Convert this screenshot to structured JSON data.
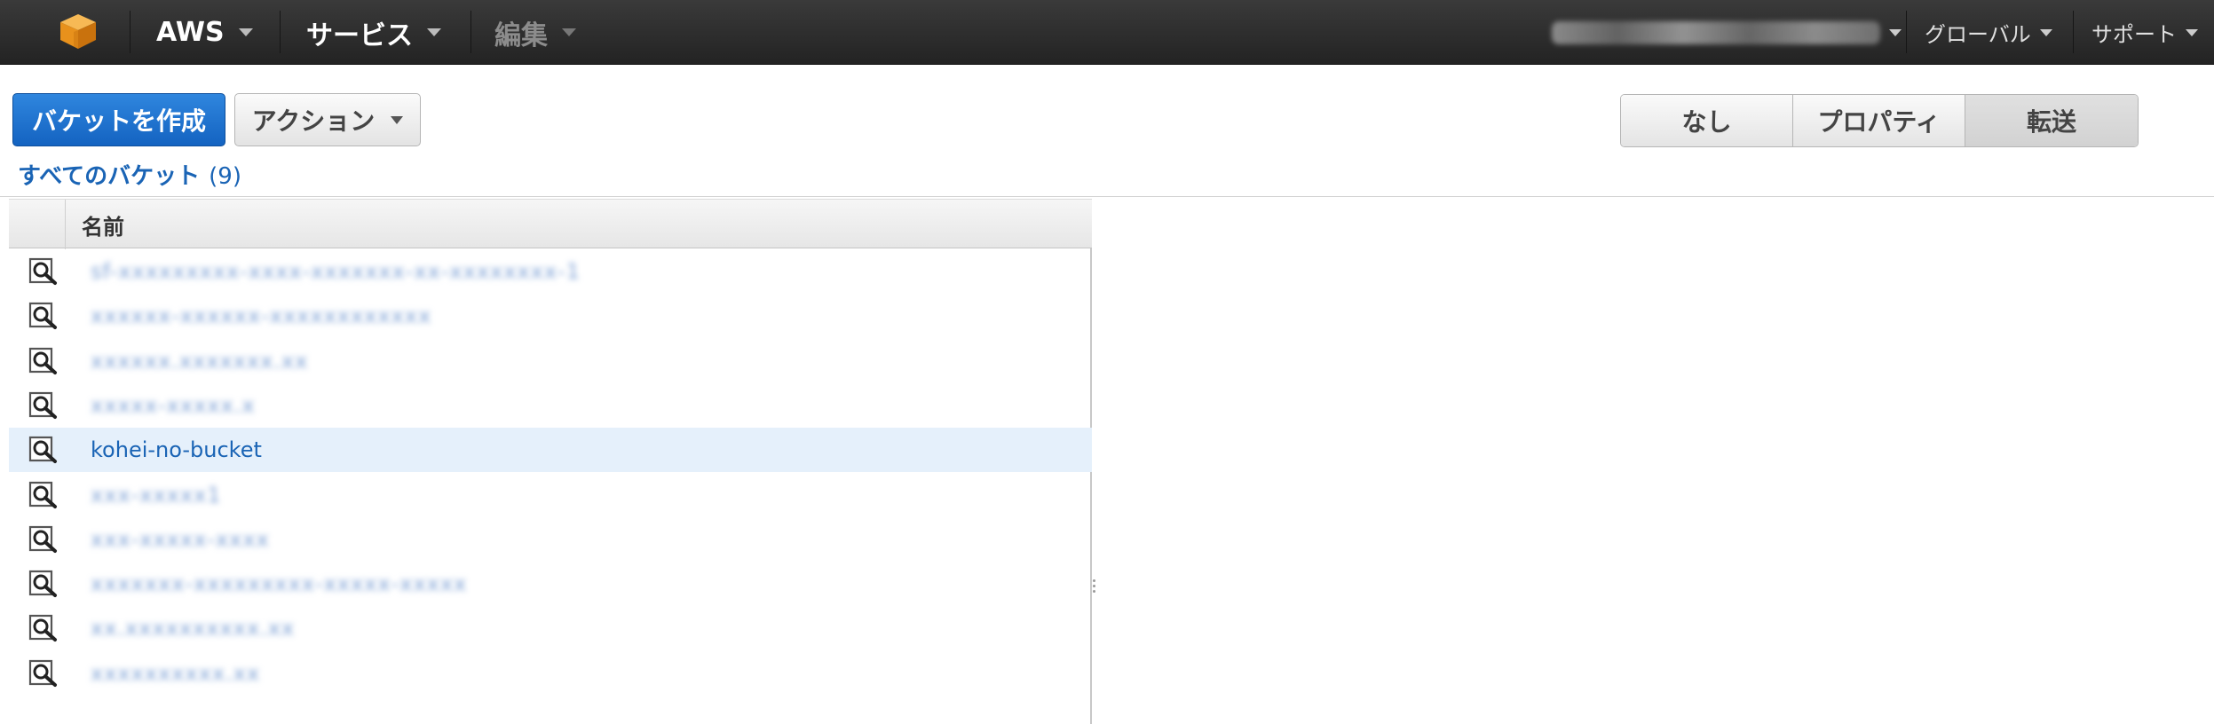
{
  "colors": {
    "topbar": "#232323",
    "logo_orange": "#f29c1f",
    "primary_blue": "#1463c1",
    "link_blue": "#1a64b5",
    "selected_row": "#e5f0fb"
  },
  "nav": {
    "logo_icon": "aws-cube-icon",
    "items": [
      {
        "label": "AWS"
      },
      {
        "label": "サービス"
      },
      {
        "label": "編集"
      }
    ],
    "region_label": "グローバル",
    "support_label": "サポート"
  },
  "toolbar": {
    "create_bucket_label": "バケットを作成",
    "actions_label": "アクション",
    "view_modes": [
      {
        "label": "なし"
      },
      {
        "label": "プロパティ"
      },
      {
        "label": "転送"
      }
    ],
    "selected_view": "転送"
  },
  "buckets": {
    "heading": "すべてのバケット",
    "count": "(9)",
    "column_name": "名前",
    "row_icon": "bucket-magnifier-icon",
    "rows": [
      {
        "name": "sf-xxxxxxxxx-xxxx-xxxxxxx-xx-xxxxxxxx-1",
        "blurred": true,
        "selected": false
      },
      {
        "name": "xxxxxx-xxxxxx-xxxxxxxxxxxx",
        "blurred": true,
        "selected": false
      },
      {
        "name": "xxxxxx.xxxxxxx.xx",
        "blurred": true,
        "selected": false
      },
      {
        "name": "xxxxx-xxxxx.x",
        "blurred": true,
        "selected": false
      },
      {
        "name": "kohei-no-bucket",
        "blurred": false,
        "selected": true
      },
      {
        "name": "xxx-xxxxx1",
        "blurred": true,
        "selected": false
      },
      {
        "name": "xxx-xxxxx-xxxx",
        "blurred": true,
        "selected": false
      },
      {
        "name": "xxxxxxx-xxxxxxxxx-xxxxx-xxxxx",
        "blurred": true,
        "selected": false
      },
      {
        "name": "xx.xxxxxxxxxx.xx",
        "blurred": true,
        "selected": false
      },
      {
        "name": "xxxxxxxxxx.xx",
        "blurred": true,
        "selected": false
      }
    ]
  }
}
